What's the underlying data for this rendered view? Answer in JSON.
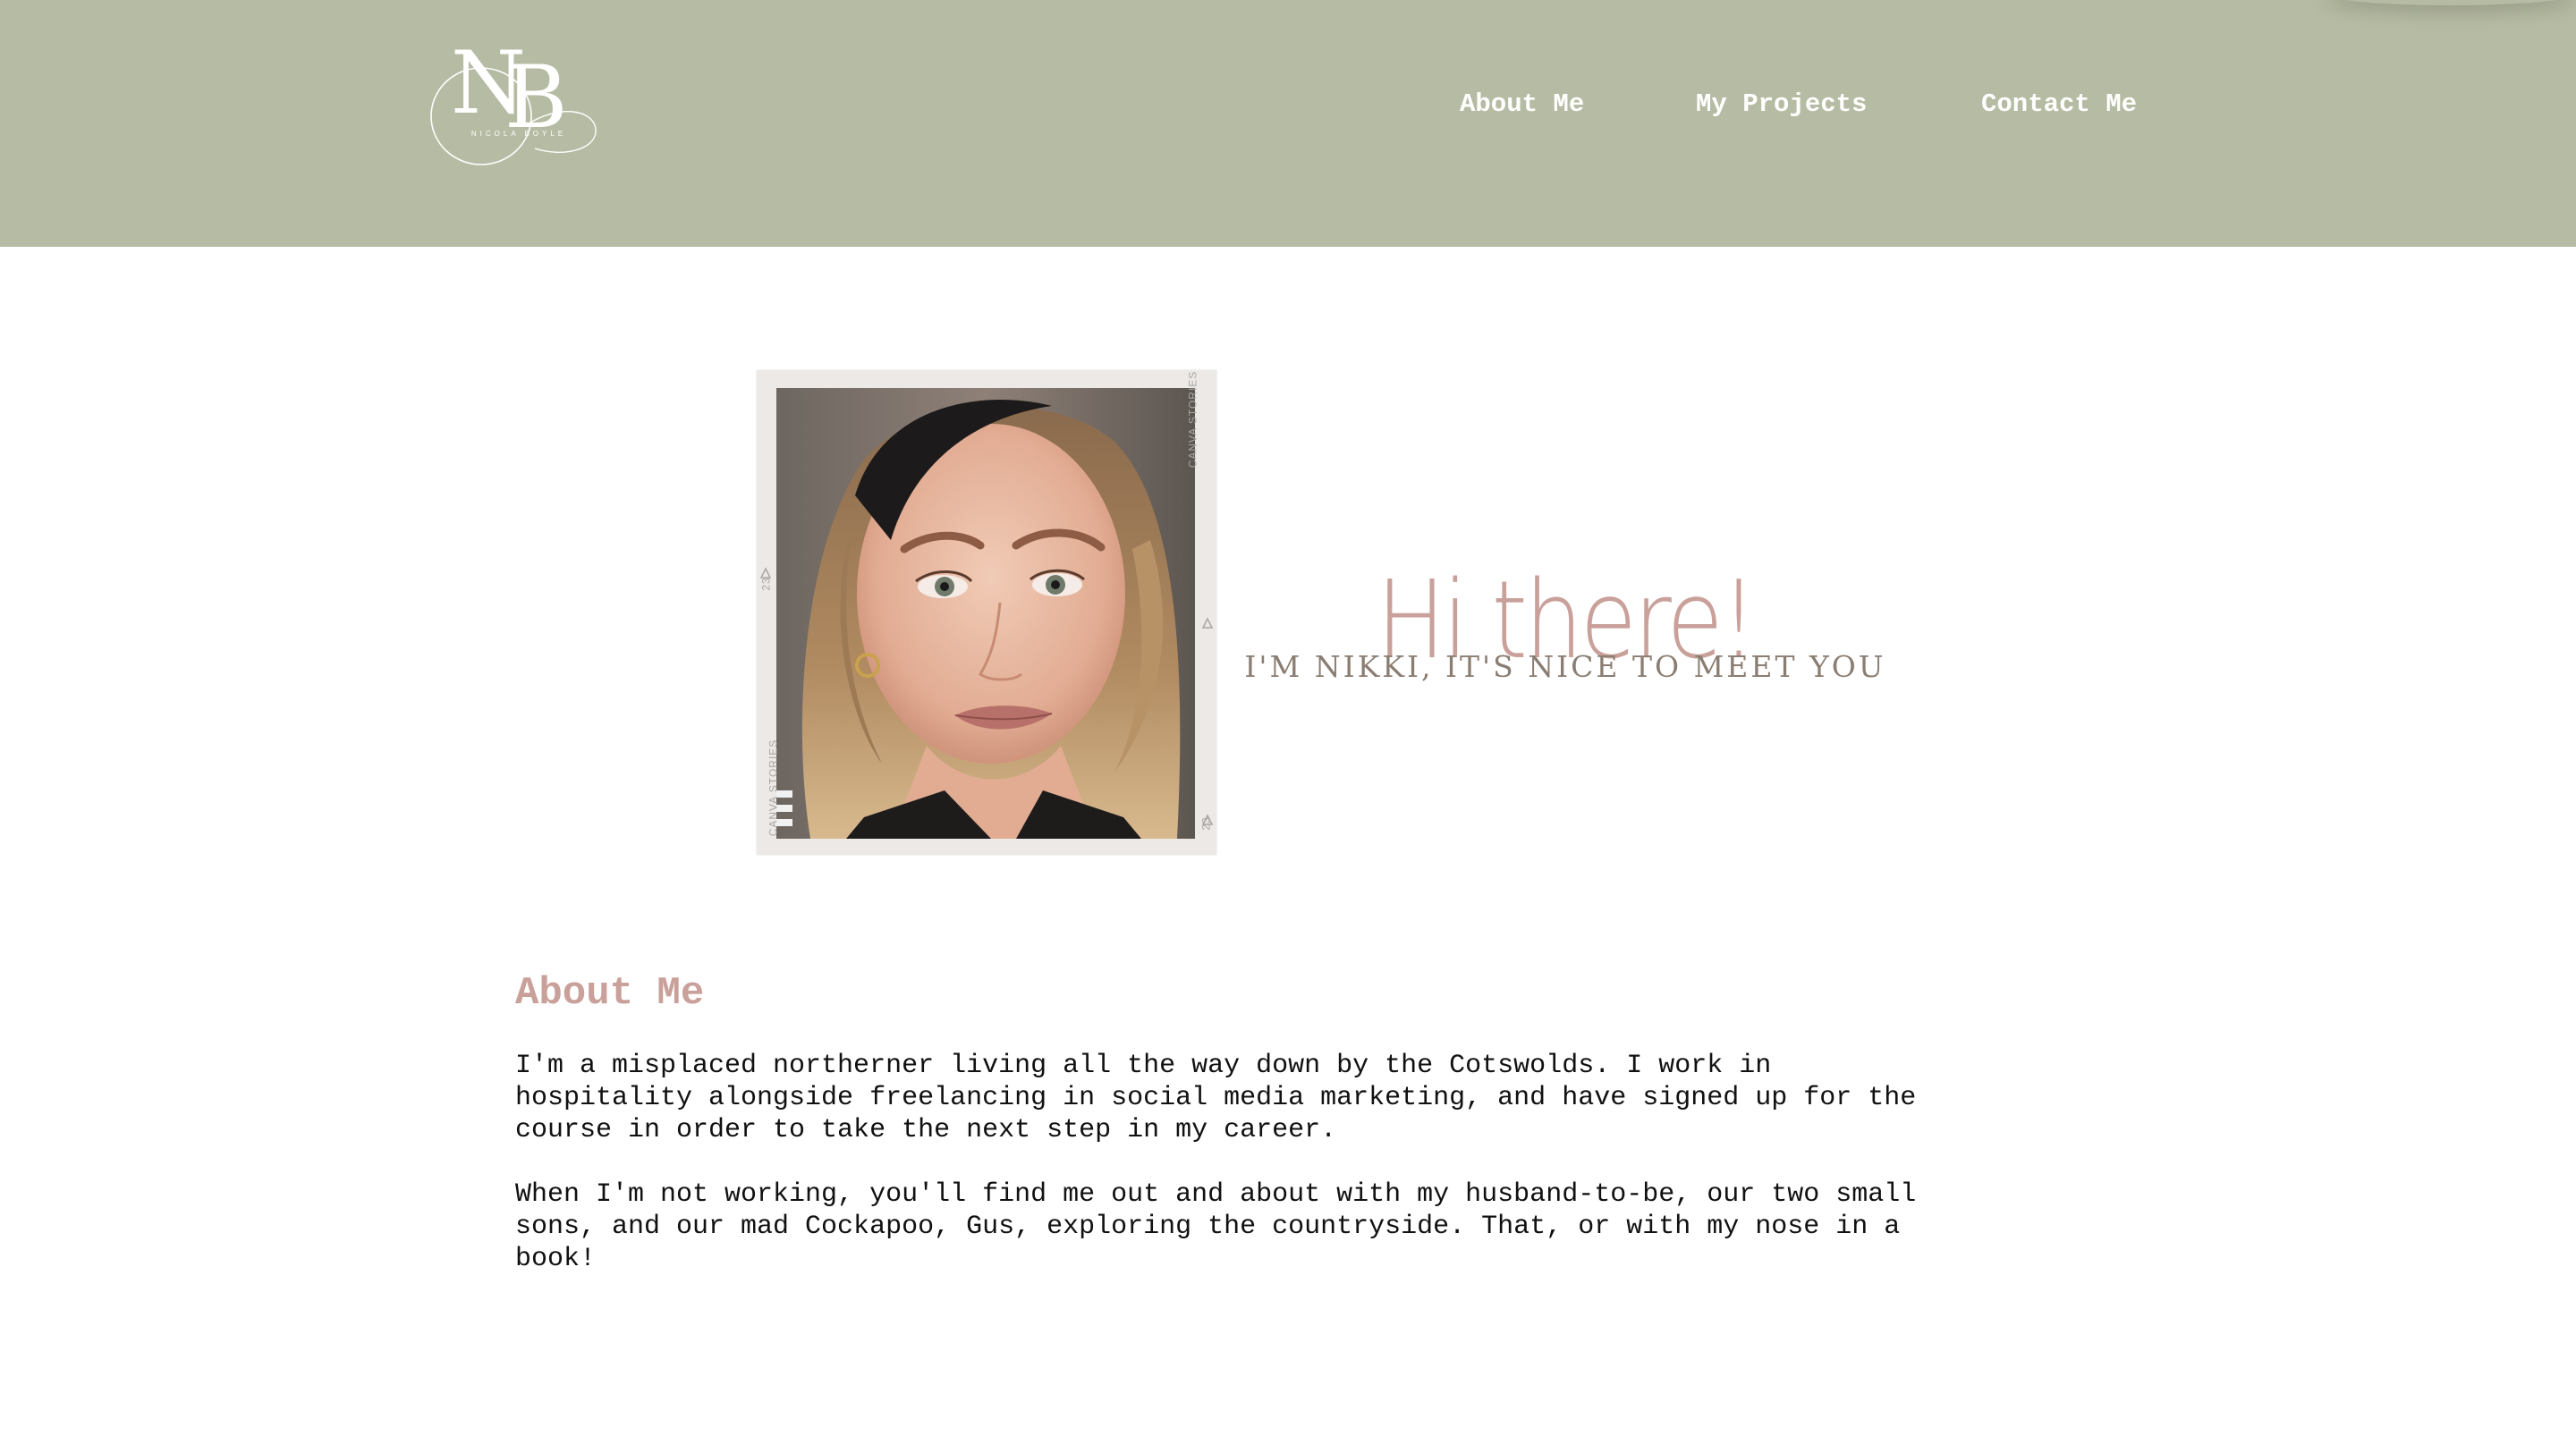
{
  "header": {
    "logo": {
      "monogram": "NB",
      "caption": "NICOLA BOYLE"
    },
    "nav": [
      {
        "label": "About Me"
      },
      {
        "label": "My Projects"
      },
      {
        "label": "Contact Me"
      }
    ],
    "background_color": "#b6bba3"
  },
  "hero": {
    "photo": {
      "frame_text": "CANVA STORIES",
      "frame_number": "23"
    },
    "title": "Hi there!",
    "subtitle": "I'M NIKKI, IT'S NICE TO MEET YOU",
    "accent_color": "#c9a09a"
  },
  "about": {
    "heading": "About Me",
    "paragraphs": [
      "I'm a misplaced northerner living all the way down by the Cotswolds. I work in\nhospitality alongside freelancing in social media marketing, and have signed up for the\ncourse in order to take the next step in my career.",
      "When I'm not working, you'll find me out and about with my husband-to-be, our two small\nsons, and our mad Cockapoo, Gus, exploring the countryside. That, or with my nose in a\nbook!"
    ]
  }
}
